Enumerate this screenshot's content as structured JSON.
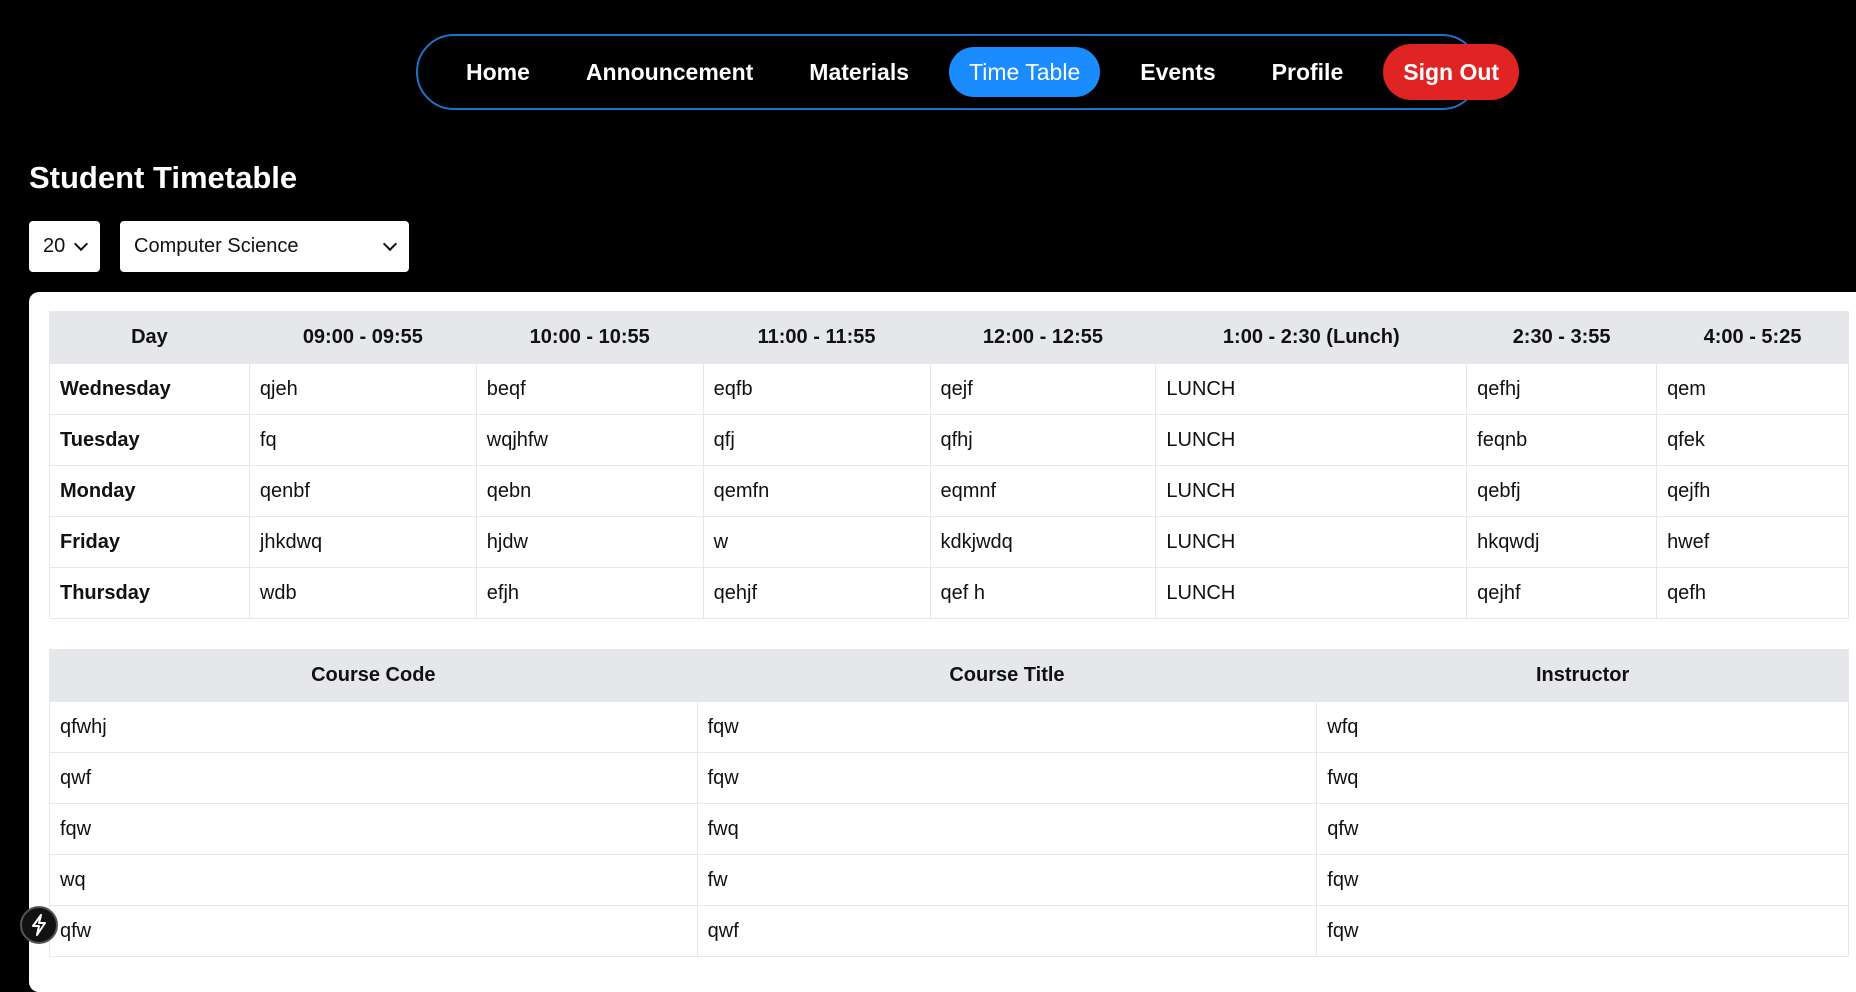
{
  "nav": {
    "items": [
      {
        "label": "Home"
      },
      {
        "label": "Announcement"
      },
      {
        "label": "Materials"
      },
      {
        "label": "Time Table",
        "active": true
      },
      {
        "label": "Events"
      },
      {
        "label": "Profile"
      }
    ],
    "sign_out_label": "Sign Out"
  },
  "page": {
    "title": "Student Timetable"
  },
  "filters": {
    "year_value": "20",
    "department_value": "Computer Science"
  },
  "timetable": {
    "headers": [
      "Day",
      "09:00 - 09:55",
      "10:00 - 10:55",
      "11:00 - 11:55",
      "12:00 - 12:55",
      "1:00 - 2:30 (Lunch)",
      "2:30 - 3:55",
      "4:00 - 5:25"
    ],
    "rows": [
      [
        "Wednesday",
        "qjeh",
        "beqf",
        "eqfb",
        "qejf",
        "LUNCH",
        "qefhj",
        "qem"
      ],
      [
        "Tuesday",
        "fq",
        "wqjhfw",
        "qfj",
        "qfhj",
        "LUNCH",
        "feqnb",
        "qfek"
      ],
      [
        "Monday",
        "qenbf",
        "qebn",
        "qemfn",
        "eqmnf",
        "LUNCH",
        "qebfj",
        "qejfh"
      ],
      [
        "Friday",
        "jhkdwq",
        "hjdw",
        "w",
        "kdkjwdq",
        "LUNCH",
        "hkqwdj",
        "hwef"
      ],
      [
        "Thursday",
        "wdb",
        "efjh",
        "qehjf",
        "qef h",
        "LUNCH",
        "qejhf",
        "qefh"
      ]
    ]
  },
  "courses": {
    "headers": [
      "Course Code",
      "Course Title",
      "Instructor"
    ],
    "rows": [
      [
        "qfwhj",
        "fqw",
        "wfq"
      ],
      [
        "qwf",
        "fqw",
        "fwq"
      ],
      [
        "fqw",
        "fwq",
        "qfw"
      ],
      [
        "wq",
        "fw",
        "fqw"
      ],
      [
        "qfw",
        "qwf",
        "fqw"
      ]
    ]
  },
  "colors": {
    "background": "#000000",
    "active_tab": "#1a8cff",
    "sign_out": "#e02424",
    "nav_border": "#1e73c8",
    "table_header": "#e5e7eb"
  },
  "icons": {
    "floating_button": "lightning-bolt-icon"
  }
}
